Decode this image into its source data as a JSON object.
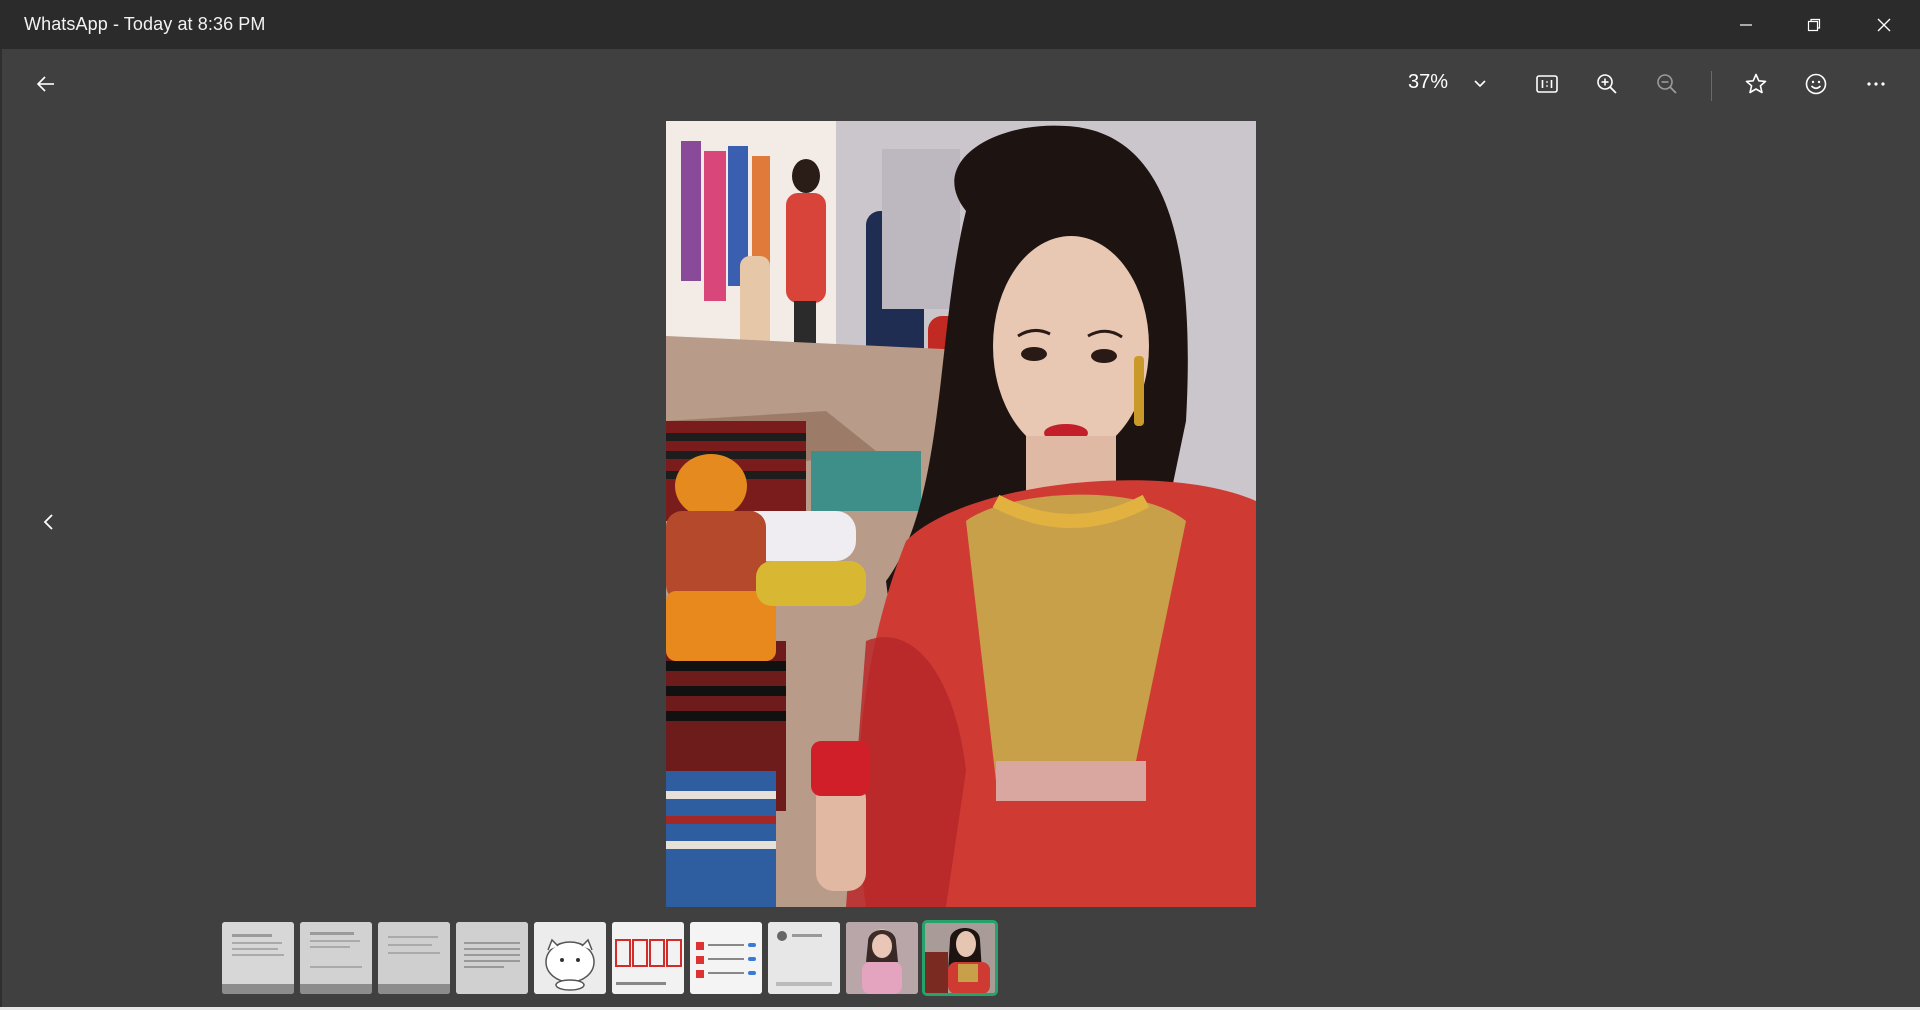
{
  "window": {
    "title": "WhatsApp - Today at 8:36 PM"
  },
  "toolbar": {
    "back_icon": "arrow-left-icon",
    "zoom_level": "37%",
    "zoom_dropdown_icon": "chevron-down-icon",
    "actual_size_icon": "actual-size-1-1-icon",
    "zoom_in_icon": "zoom-in-icon",
    "zoom_out_icon": "zoom-out-icon",
    "favorite_icon": "star-icon",
    "reaction_icon": "smiley-icon",
    "more_icon": "ellipsis-icon"
  },
  "viewer": {
    "previous_icon": "chevron-left-icon"
  },
  "filmstrip": {
    "thumbnails": [
      {
        "kind": "document-screenshot",
        "selected": false
      },
      {
        "kind": "document-screenshot",
        "selected": false
      },
      {
        "kind": "document-screenshot",
        "selected": false
      },
      {
        "kind": "document-screenshot",
        "selected": false
      },
      {
        "kind": "cartoon-sticker",
        "selected": false
      },
      {
        "kind": "app-screenshot-red",
        "selected": false
      },
      {
        "kind": "app-screenshot-list",
        "selected": false
      },
      {
        "kind": "app-screenshot-profile",
        "selected": false
      },
      {
        "kind": "photo-pink-outfit",
        "selected": false
      },
      {
        "kind": "photo-red-outfit",
        "selected": true
      }
    ]
  },
  "colors": {
    "background": "#404040",
    "titlebar": "#2b2b2b",
    "selection": "#25a36a"
  }
}
